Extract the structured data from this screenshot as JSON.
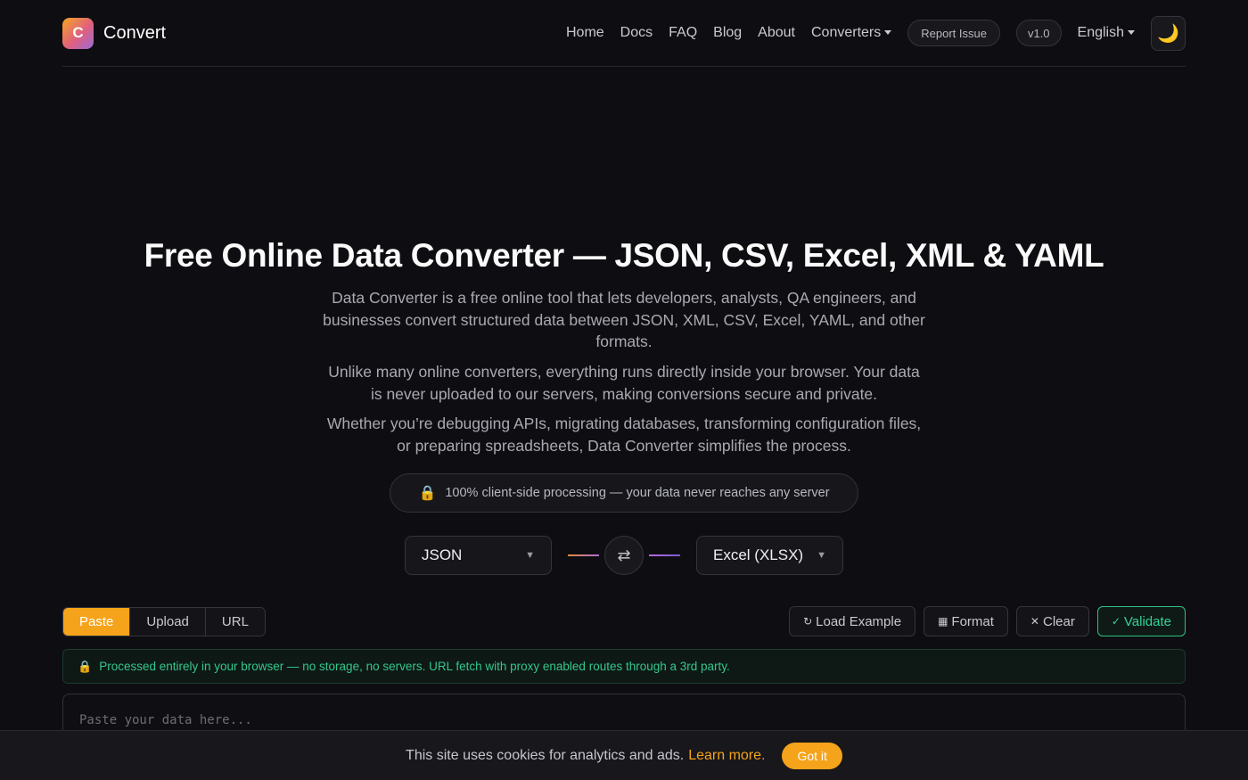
{
  "header": {
    "logo_letter": "C",
    "brand": "Convert",
    "nav": [
      "Home",
      "Docs",
      "FAQ",
      "Blog",
      "About"
    ],
    "converters_label": "Converters",
    "report_issue": "Report Issue",
    "version": "v1.0",
    "language": "English",
    "theme_icon": "🌙"
  },
  "hero": {
    "title": "Free Online Data Converter — JSON, CSV, Excel, XML & YAML",
    "p1": "Data Converter is a free online tool that lets developers, analysts, QA engineers, and businesses convert structured data between JSON, XML, CSV, Excel, YAML, and other formats.",
    "p2": "Unlike many online converters, everything runs directly inside your browser. Your data is never uploaded to our servers, making conversions secure and private.",
    "p3": "Whether you’re debugging APIs, migrating databases, transforming configuration files, or preparing spreadsheets, Data Converter simplifies the process.",
    "privacy": "100% client-side processing — your data never reaches any server"
  },
  "converter": {
    "from_format": "JSON",
    "to_format": "Excel (XLSX)",
    "swap_icon": "⇄",
    "tabs": [
      "Paste",
      "Upload",
      "URL"
    ],
    "active_tab": "Paste",
    "actions": {
      "load_example": "Load Example",
      "format": "Format",
      "clear": "Clear",
      "validate": "Validate"
    },
    "notice": "Processed entirely in your browser — no storage, no servers. URL fetch with proxy enabled routes through a 3rd party.",
    "editor_placeholder": "Paste your data here..."
  },
  "cookie": {
    "text": "This site uses cookies for analytics and ads.",
    "learn_more": "Learn more.",
    "accept": "Got it"
  },
  "colors": {
    "accent": "#f5a31a",
    "success": "#34d399",
    "background": "#0e0e12"
  }
}
